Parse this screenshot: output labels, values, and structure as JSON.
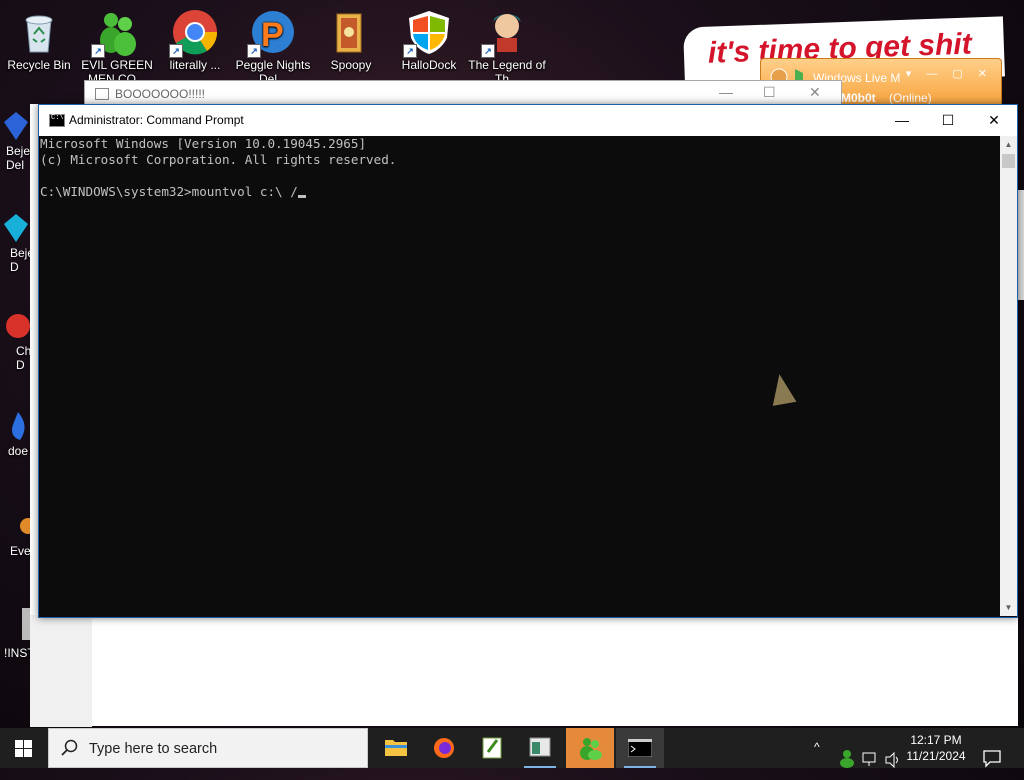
{
  "desktop": {
    "icons": [
      {
        "label": "Recycle Bin"
      },
      {
        "label": "EVIL GREEN MEN CO..."
      },
      {
        "label": "literally ..."
      },
      {
        "label": "Peggle Nights Del..."
      },
      {
        "label": "Spoopy"
      },
      {
        "label": "HalloDock"
      },
      {
        "label": "The Legend of Th..."
      }
    ],
    "left_icons": [
      {
        "label": "Bejew Del"
      },
      {
        "label": "Beje D"
      },
      {
        "label": "Ch D"
      },
      {
        "label": "doe"
      },
      {
        "label": "Eve"
      },
      {
        "label": "!INST"
      }
    ],
    "banner_text": "it's time to get shit"
  },
  "wlm": {
    "title": "Windows Live M",
    "user": "M0b0t",
    "status": "(Online)"
  },
  "bg_window": {
    "title": "BOOOOOOO!!!!!"
  },
  "cmd": {
    "title": "Administrator: Command Prompt",
    "lines": [
      "Microsoft Windows [Version 10.0.19045.2965]",
      "(c) Microsoft Corporation. All rights reserved.",
      "",
      "C:\\WINDOWS\\system32>mountvol c:\\ /"
    ]
  },
  "taskbar": {
    "search_placeholder": "Type here to search",
    "time": "12:17 PM",
    "date": "11/21/2024"
  }
}
